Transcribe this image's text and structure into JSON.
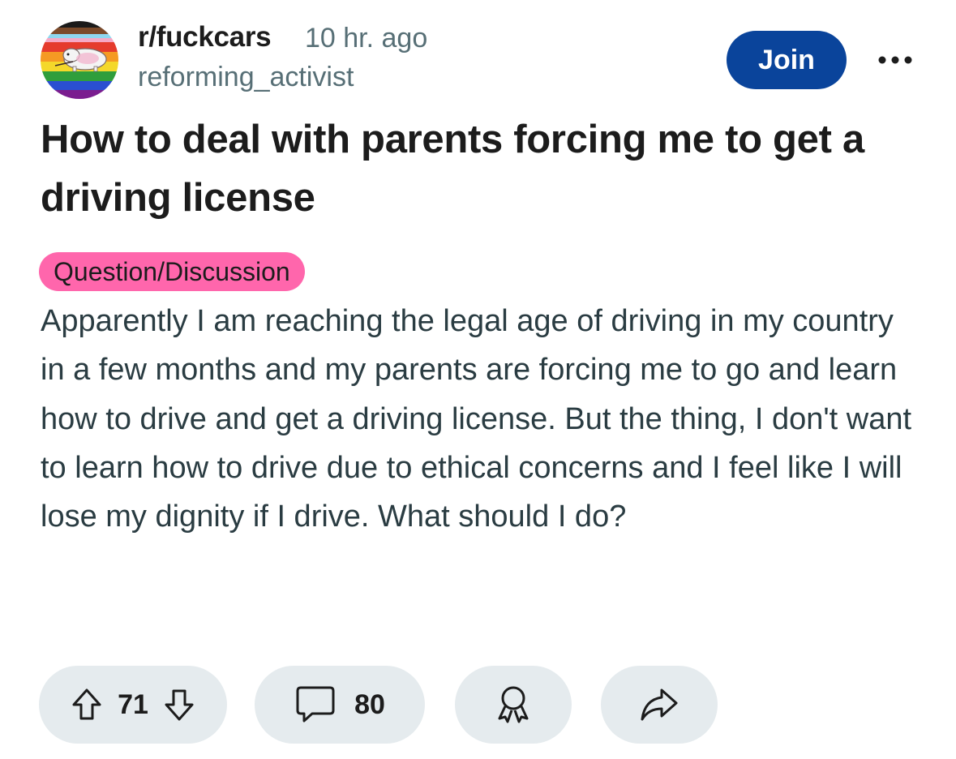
{
  "post": {
    "subreddit": "r/fuckcars",
    "time_ago": "10 hr. ago",
    "username": "reforming_activist",
    "join_label": "Join",
    "title": "How to deal with parents forcing me to get a driving license",
    "flair": "Question/Discussion",
    "body": "Apparently I am reaching the legal age of driving in my country in a few months and my parents are forcing me to go and learn how to drive and get a driving license. But the thing, I don't want to learn how to drive due to ethical concerns and I feel like I will lose my dignity if I drive. What should I do?"
  },
  "actions": {
    "score": "71",
    "comments": "80"
  },
  "icons": {
    "avatar": "subreddit-avatar",
    "more": "more-icon",
    "upvote": "upvote-icon",
    "downvote": "downvote-icon",
    "comment": "comment-icon",
    "award": "award-icon",
    "share": "share-icon"
  },
  "colors": {
    "join_button": "#0a449b",
    "flair_bg": "#ff66ac",
    "pill_bg": "#e5ebee",
    "meta_text": "#576f76",
    "body_text": "#2a3c42"
  }
}
